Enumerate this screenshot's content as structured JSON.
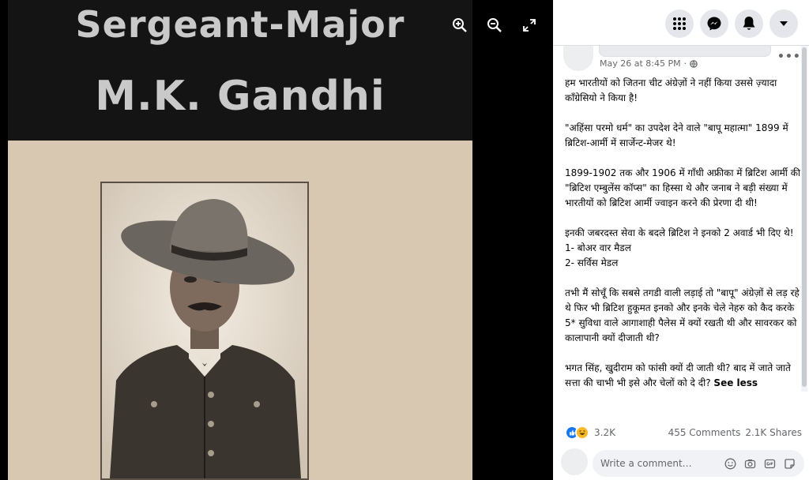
{
  "poster": {
    "title_line1": "Sergeant-Major",
    "title_line2": "M.K. Gandhi"
  },
  "viewer_tools": [
    "zoom-in-icon",
    "zoom-out-icon",
    "fullscreen-icon"
  ],
  "topbar": {
    "buttons": [
      "menu-grid-icon",
      "messenger-icon",
      "notifications-bell-icon",
      "account-dropdown-icon"
    ]
  },
  "post": {
    "date": "May 26 at 8:45 PM",
    "more": "•••",
    "paragraphs": [
      "हम भारतीयों को जितना चीट अंग्रेज़ों ने नहीं किया उससे ज़्यादा कॉंग्रेसियो ने किया है!",
      "\"अहिंसा परमो धर्म\" का उपदेश देने वाले \"बापू महात्मा\" 1899 में ब्रिटिश-आर्मी में सार्जेन्ट-मेजर थे!",
      "1899-1902 तक और 1906 में गाँधी अफ्रीका में ब्रिटिश आर्मी की \"ब्रिटिश एम्बुलेंस कॉप्स\" का हिस्सा थे और जनाब ने बड़ी संख्या में भारतीयों को ब्रिटिश आर्मी ज्वाइन करने की प्रेरणा दी थी!",
      "इनकी जबरदस्त सेवा के बदले ब्रिटिश ने इनको 2 अवार्ड भी दिए थे!\n1- बोअर वार मैडल\n2- सर्विस मेडल",
      "तभी मैं सोचूँ कि सबसे तगडी वाली लड़ाई तो \"बापू\" अंग्रेज़ों से लड़ रहे थे फिर भी ब्रिटिश हुकूमत इनको और इनके चेले नेहरु को कैद करके 5* सुविधा वाले आगाशाही पैलेस में क्यों रखती थी और सावरकर को कालापानी क्यों दीजाती थी?",
      "भगत सिंह, खुदीराम को फांसी क्यों दी जाती थी? बाद में जाते जाते सत्ता की चाभी भी इसे और चेलों को दे दी?"
    ],
    "see_less": "See less",
    "reactions": {
      "count": "3.2K",
      "comments": "455 Comments",
      "shares": "2.1K Shares",
      "colors": {
        "like": "#1877f2",
        "haha": "#f7b928"
      }
    },
    "comment_placeholder": "Write a comment…"
  }
}
